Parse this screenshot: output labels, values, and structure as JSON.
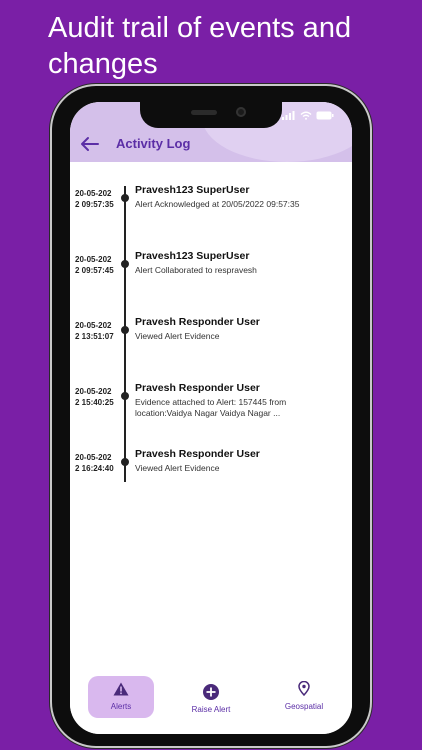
{
  "promo": {
    "headline": "Audit trail of events and changes"
  },
  "header": {
    "title": "Activity Log"
  },
  "activity": [
    {
      "time": "20-05-2022 09:57:35",
      "user": "Pravesh123 SuperUser",
      "description": "Alert Acknowledged at 20/05/2022 09:57:35"
    },
    {
      "time": "20-05-2022 09:57:45",
      "user": "Pravesh123 SuperUser",
      "description": "Alert Collaborated to respravesh"
    },
    {
      "time": "20-05-2022 13:51:07",
      "user": "Pravesh Responder User",
      "description": "Viewed Alert Evidence"
    },
    {
      "time": "20-05-2022 15:40:25",
      "user": "Pravesh Responder User",
      "description": "Evidence attached to Alert: 157445 from location:Vaidya Nagar Vaidya Nagar ..."
    },
    {
      "time": "20-05-2022 16:24:40",
      "user": "Pravesh Responder User",
      "description": "Viewed Alert Evidence"
    }
  ],
  "nav": {
    "alerts": "Alerts",
    "raise_alert": "Raise Alert",
    "geospatial": "Geospatial"
  },
  "colors": {
    "background": "#7a1fa6",
    "accent": "#5b2ea6",
    "header": "#d4c0ea",
    "active_tab": "#d9b8ee"
  },
  "icons": {
    "back": "arrow-left-icon",
    "alerts": "warning-icon",
    "raise_alert": "plus-circle-icon",
    "geospatial": "location-pin-icon"
  }
}
